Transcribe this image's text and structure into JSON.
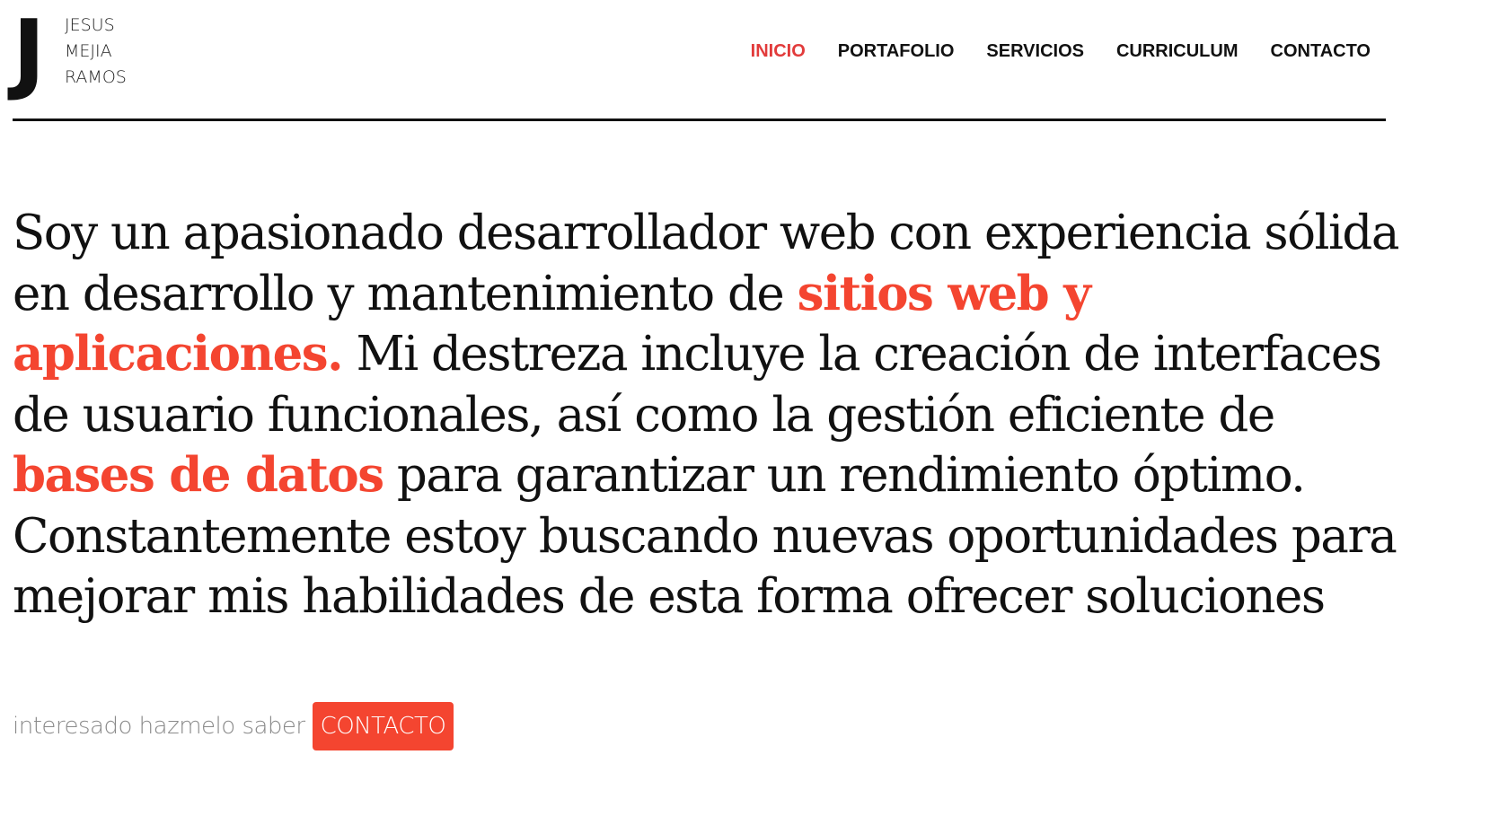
{
  "brand": {
    "logo_letter": "J",
    "name_lines": [
      "JESUS",
      "MEJIA",
      "RAMOS"
    ]
  },
  "nav": {
    "items": [
      {
        "label": "INICIO",
        "active": true
      },
      {
        "label": "PORTAFOLIO",
        "active": false
      },
      {
        "label": "SERVICIOS",
        "active": false
      },
      {
        "label": "CURRICULUM",
        "active": false
      },
      {
        "label": "CONTACTO",
        "active": false
      }
    ]
  },
  "intro": {
    "part1": "Soy un apasionado desarrollador web con experiencia sólida en desarrollo y mantenimiento de ",
    "highlight1": "sitios web y aplicaciones.",
    "part2": " Mi destreza incluye la creación de interfaces de usuario funcionales, así como la gestión eficiente de ",
    "highlight2": "bases de datos",
    "part3": " para garantizar un rendimiento óptimo. Constantemente estoy buscando nuevas oportunidades para mejorar mis habilidades de esta forma ofrecer soluciones"
  },
  "cta": {
    "text": "interesado hazmelo saber",
    "button_label": "CONTACTO"
  },
  "colors": {
    "accent": "#f44530",
    "nav_active": "#e23b3b",
    "text": "#111111",
    "muted": "#8a8a8a"
  }
}
